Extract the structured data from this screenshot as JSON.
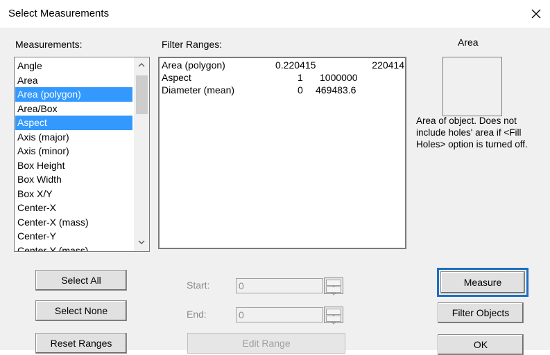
{
  "window": {
    "title": "Select Measurements"
  },
  "labels": {
    "measurements": "Measurements:",
    "filter_ranges": "Filter Ranges:",
    "preview_title": "Area",
    "start": "Start:",
    "end": "End:"
  },
  "measurements": [
    {
      "label": "Angle",
      "selected": false
    },
    {
      "label": "Area",
      "selected": false
    },
    {
      "label": "Area (polygon)",
      "selected": true
    },
    {
      "label": "Area/Box",
      "selected": false
    },
    {
      "label": "Aspect",
      "selected": true
    },
    {
      "label": "Axis (major)",
      "selected": false
    },
    {
      "label": "Axis (minor)",
      "selected": false
    },
    {
      "label": "Box Height",
      "selected": false
    },
    {
      "label": "Box Width",
      "selected": false
    },
    {
      "label": "Box X/Y",
      "selected": false
    },
    {
      "label": "Center-X",
      "selected": false
    },
    {
      "label": "Center-X (mass)",
      "selected": false
    },
    {
      "label": "Center-Y",
      "selected": false
    },
    {
      "label": "Center-Y (mass)",
      "selected": false
    }
  ],
  "filter_ranges": [
    {
      "name": "Area (polygon)",
      "start": "0.220415",
      "end": "220414"
    },
    {
      "name": "Aspect",
      "start": "1",
      "end": "1000000"
    },
    {
      "name": "Diameter (mean)",
      "start": "0",
      "end": "469483.6"
    }
  ],
  "description": "Area of object. Does not include holes' area if <Fill Holes> option is turned off.",
  "inputs": {
    "start_value": "0",
    "end_value": "0"
  },
  "buttons": {
    "select_all": "Select All",
    "select_none": "Select None",
    "reset_ranges": "Reset Ranges",
    "edit_range": "Edit Range",
    "measure": "Measure",
    "filter_objects": "Filter Objects",
    "ok": "OK"
  },
  "colors": {
    "selection": "#3399ff",
    "focus_highlight": "#1e6ec1",
    "dialog_bg": "#f0f0f0"
  }
}
